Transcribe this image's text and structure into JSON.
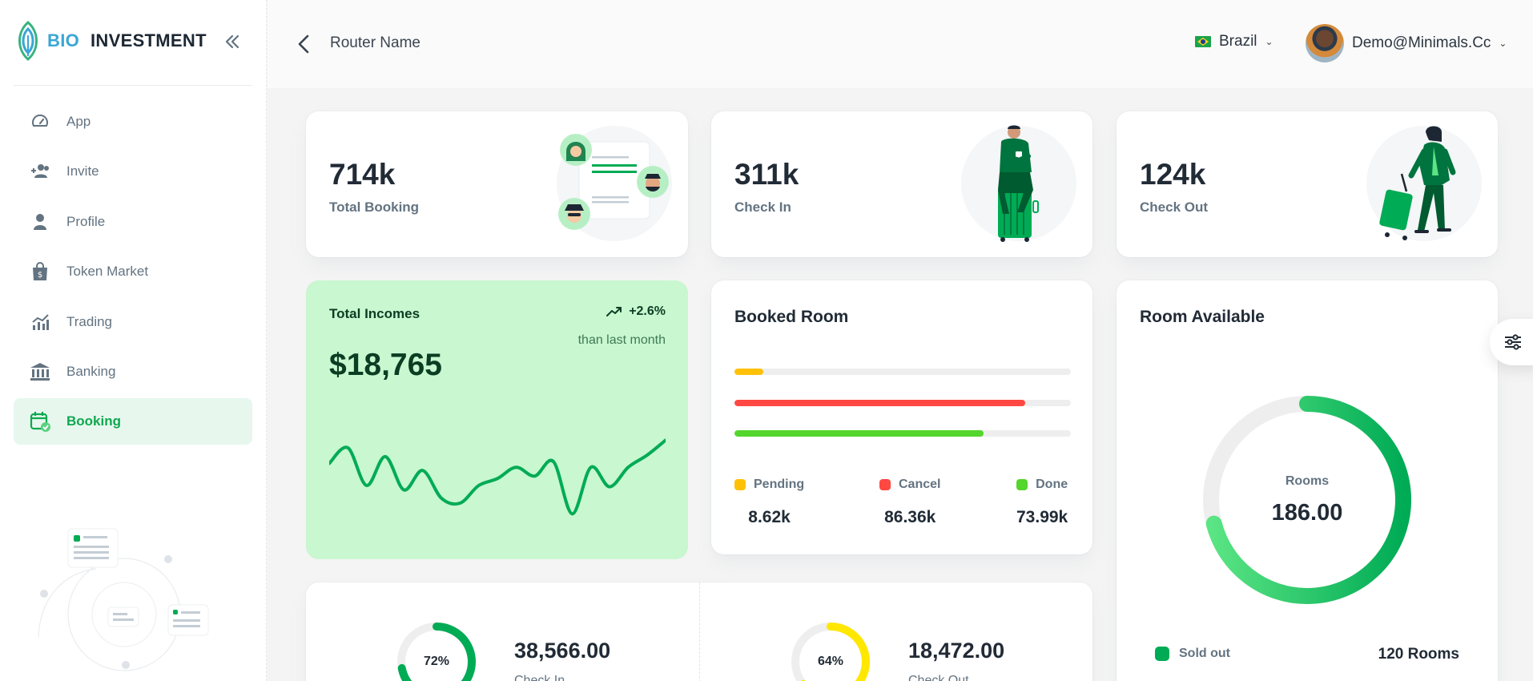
{
  "brand": {
    "bio": "BIO",
    "investment": "INVESTMENT"
  },
  "sidebar": {
    "items": [
      {
        "label": "App",
        "icon": "speedometer-icon"
      },
      {
        "label": "Invite",
        "icon": "users-add-icon"
      },
      {
        "label": "Profile",
        "icon": "user-icon"
      },
      {
        "label": "Token Market",
        "icon": "shopping-bag-icon"
      },
      {
        "label": "Trading",
        "icon": "bar-chart-icon"
      },
      {
        "label": "Banking",
        "icon": "bank-icon"
      },
      {
        "label": "Booking",
        "icon": "calendar-check-icon",
        "active": true
      }
    ]
  },
  "header": {
    "router_name": "Router Name",
    "language": "Brazil",
    "user_email": "Demo@Minimals.Cc"
  },
  "stats": [
    {
      "value": "714k",
      "label": "Total Booking"
    },
    {
      "value": "311k",
      "label": "Check In"
    },
    {
      "value": "124k",
      "label": "Check Out"
    }
  ],
  "income": {
    "title": "Total Incomes",
    "trend": "+2.6%",
    "trend_sub": "than last month",
    "value": "$18,765",
    "chart_data": {
      "type": "line",
      "values": [
        111,
        136,
        76,
        122,
        69,
        100,
        56,
        48,
        76,
        87,
        105,
        91,
        114,
        31,
        105,
        74,
        105,
        124,
        148
      ]
    }
  },
  "booked_room": {
    "title": "Booked Room",
    "colors": {
      "pending": "#ffc107",
      "cancel": "#ff4842",
      "done": "#54d62c"
    },
    "bars": [
      {
        "key": "pending",
        "fraction": 0.086
      },
      {
        "key": "cancel",
        "fraction": 0.864
      },
      {
        "key": "done",
        "fraction": 0.74
      }
    ],
    "legend": [
      {
        "label": "Pending",
        "value": "8.62k",
        "color": "#ffc107"
      },
      {
        "label": "Cancel",
        "value": "86.36k",
        "color": "#ff4842"
      },
      {
        "label": "Done",
        "value": "73.99k",
        "color": "#54d62c"
      }
    ]
  },
  "room_available": {
    "title": "Room Available",
    "center_label": "Rooms",
    "center_value": "186.00",
    "fraction": 0.71,
    "legend_label": "Sold out",
    "legend_value": "120 Rooms"
  },
  "summary": [
    {
      "percent": "72%",
      "fraction": 0.72,
      "value": "38,566.00",
      "label": "Check In",
      "color": "#00ab55"
    },
    {
      "percent": "64%",
      "fraction": 0.64,
      "value": "18,472.00",
      "label": "Check Out",
      "color": "#ffe700"
    }
  ]
}
